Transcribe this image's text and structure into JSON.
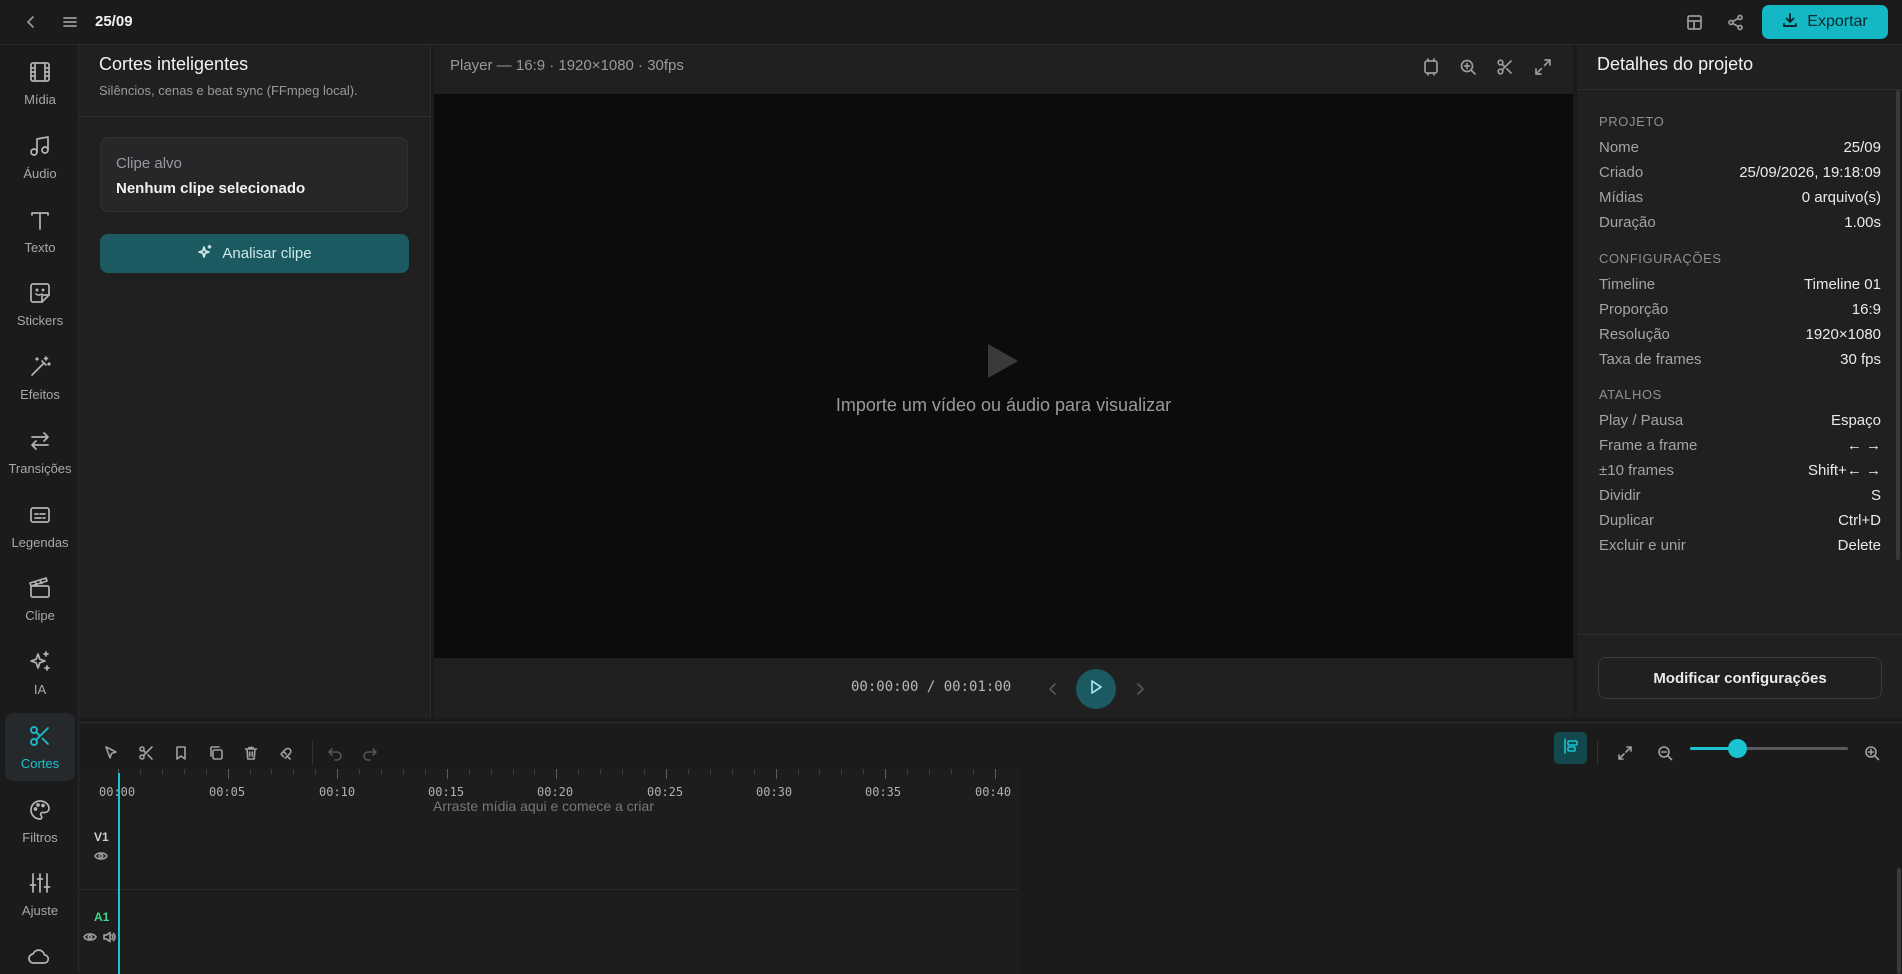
{
  "header": {
    "project_name": "25/09",
    "export_label": "Exportar",
    "icons": [
      "back-icon",
      "menu-icon",
      "layout-icon",
      "share-icon",
      "download-icon"
    ]
  },
  "sidebar": {
    "items": [
      {
        "label": "Mídia",
        "icon": "film-icon"
      },
      {
        "label": "Áudio",
        "icon": "music-icon"
      },
      {
        "label": "Texto",
        "icon": "text-icon"
      },
      {
        "label": "Stickers",
        "icon": "sticker-icon"
      },
      {
        "label": "Efeitos",
        "icon": "magic-wand-icon"
      },
      {
        "label": "Transições",
        "icon": "transition-icon"
      },
      {
        "label": "Legendas",
        "icon": "captions-icon"
      },
      {
        "label": "Clipe",
        "icon": "clapperboard-icon"
      },
      {
        "label": "IA",
        "icon": "sparkles-icon"
      },
      {
        "label": "Cortes",
        "icon": "scissors-icon",
        "active": true
      },
      {
        "label": "Filtros",
        "icon": "palette-icon"
      },
      {
        "label": "Ajuste",
        "icon": "sliders-icon"
      }
    ]
  },
  "left_panel": {
    "title": "Cortes inteligentes",
    "subtitle": "Silêncios, cenas e beat sync (FFmpeg local).",
    "target_label": "Clipe alvo",
    "target_value": "Nenhum clipe selecionado",
    "analyze_label": "Analisar clipe"
  },
  "player": {
    "title": "Player — 16:9 · 1920×1080 · 30fps",
    "empty_message": "Importe um vídeo ou áudio para visualizar",
    "current_time": "00:00:00",
    "total_time": "/ 00:01:00"
  },
  "details": {
    "title": "Detalhes do projeto",
    "sections": [
      {
        "heading": "PROJETO",
        "rows": [
          {
            "key": "Nome",
            "value": "25/09"
          },
          {
            "key": "Criado",
            "value": "25/09/2026, 19:18:09"
          },
          {
            "key": "Mídias",
            "value": "0 arquivo(s)"
          },
          {
            "key": "Duração",
            "value": "1.00s"
          }
        ]
      },
      {
        "heading": "CONFIGURAÇÕES",
        "rows": [
          {
            "key": "Timeline",
            "value": "Timeline 01"
          },
          {
            "key": "Proporção",
            "value": "16:9"
          },
          {
            "key": "Resolução",
            "value": "1920×1080"
          },
          {
            "key": "Taxa de frames",
            "value": "30 fps"
          }
        ]
      },
      {
        "heading": "ATALHOS",
        "rows": [
          {
            "key": "Play / Pausa",
            "value": "Espaço"
          },
          {
            "key": "Frame a frame",
            "value": "← →"
          },
          {
            "key": "±10 frames",
            "value": "Shift+← →"
          },
          {
            "key": "Dividir",
            "value": "S"
          },
          {
            "key": "Duplicar",
            "value": "Ctrl+D"
          },
          {
            "key": "Excluir e unir",
            "value": "Delete"
          }
        ]
      }
    ],
    "modify_label": "Modificar configurações"
  },
  "timeline": {
    "ruler_labels": [
      "00:00",
      "00:05",
      "00:10",
      "00:15",
      "00:20",
      "00:25",
      "00:30",
      "00:35",
      "00:40"
    ],
    "drop_hint": "Arraste mídia aqui e comece a criar",
    "tracks": [
      {
        "label": "V1",
        "color": "#cfcfd2"
      },
      {
        "label": "A1",
        "color": "#3fd58a"
      }
    ],
    "zoom_level": 0.3
  },
  "colors": {
    "accent": "#19c3d2",
    "export_button": "#14b8c5",
    "background": "#1b1b1c"
  }
}
